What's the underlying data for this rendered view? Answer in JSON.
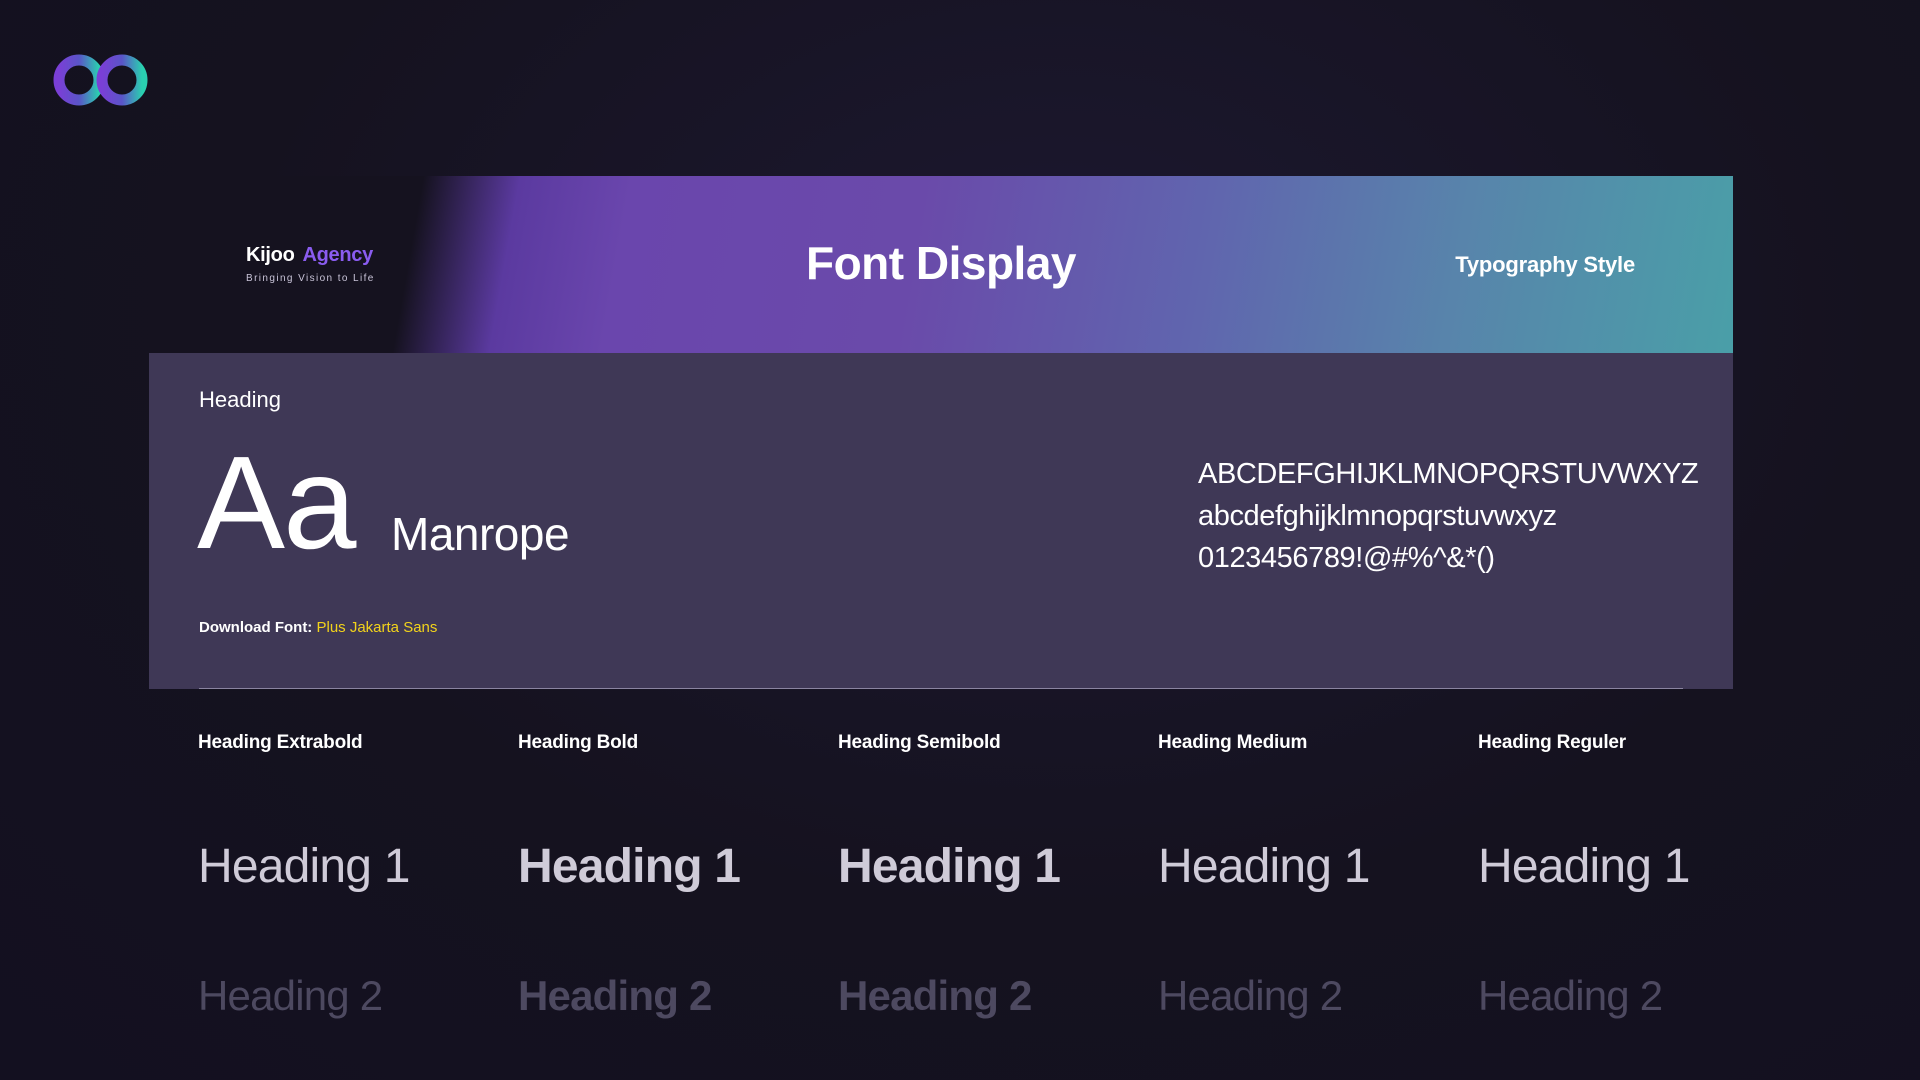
{
  "banner": {
    "brand_name_part1": "Kijoo",
    "brand_name_part2": "Agency",
    "brand_tagline": "Bringing Vision to Life",
    "title": "Font Display",
    "subtitle": "Typography Style"
  },
  "panel": {
    "label": "Heading",
    "specimen": "Aa",
    "font_name": "Manrope",
    "download_label": "Download Font:",
    "download_link": "Plus Jakarta Sans",
    "charset": {
      "uppercase": "ABCDEFGHIJKLMNOPQRSTUVWXYZ",
      "lowercase": "abcdefghijklmnopqrstuvwxyz",
      "symbols": "0123456789!@#%^&*()"
    }
  },
  "weights": [
    {
      "label": "Heading Extrabold",
      "h1": "Heading 1",
      "h2": "Heading 2"
    },
    {
      "label": "Heading Bold",
      "h1": "Heading 1",
      "h2": "Heading 2"
    },
    {
      "label": "Heading Semibold",
      "h1": "Heading 1",
      "h2": "Heading 2"
    },
    {
      "label": "Heading Medium",
      "h1": "Heading 1",
      "h2": "Heading 2"
    },
    {
      "label": "Heading Reguler",
      "h1": "Heading 1",
      "h2": "Heading 2"
    }
  ],
  "colors": {
    "background": "#15121f",
    "panel": "#3f3856",
    "accent_purple": "#6a46ad",
    "accent_teal": "#4a9fa8",
    "link_yellow": "#f2d31b",
    "brand_purple": "#8a5cf0"
  },
  "icons": {
    "logo": "infinity-logo-icon",
    "brand_mark": "infinity-mini-icon"
  }
}
